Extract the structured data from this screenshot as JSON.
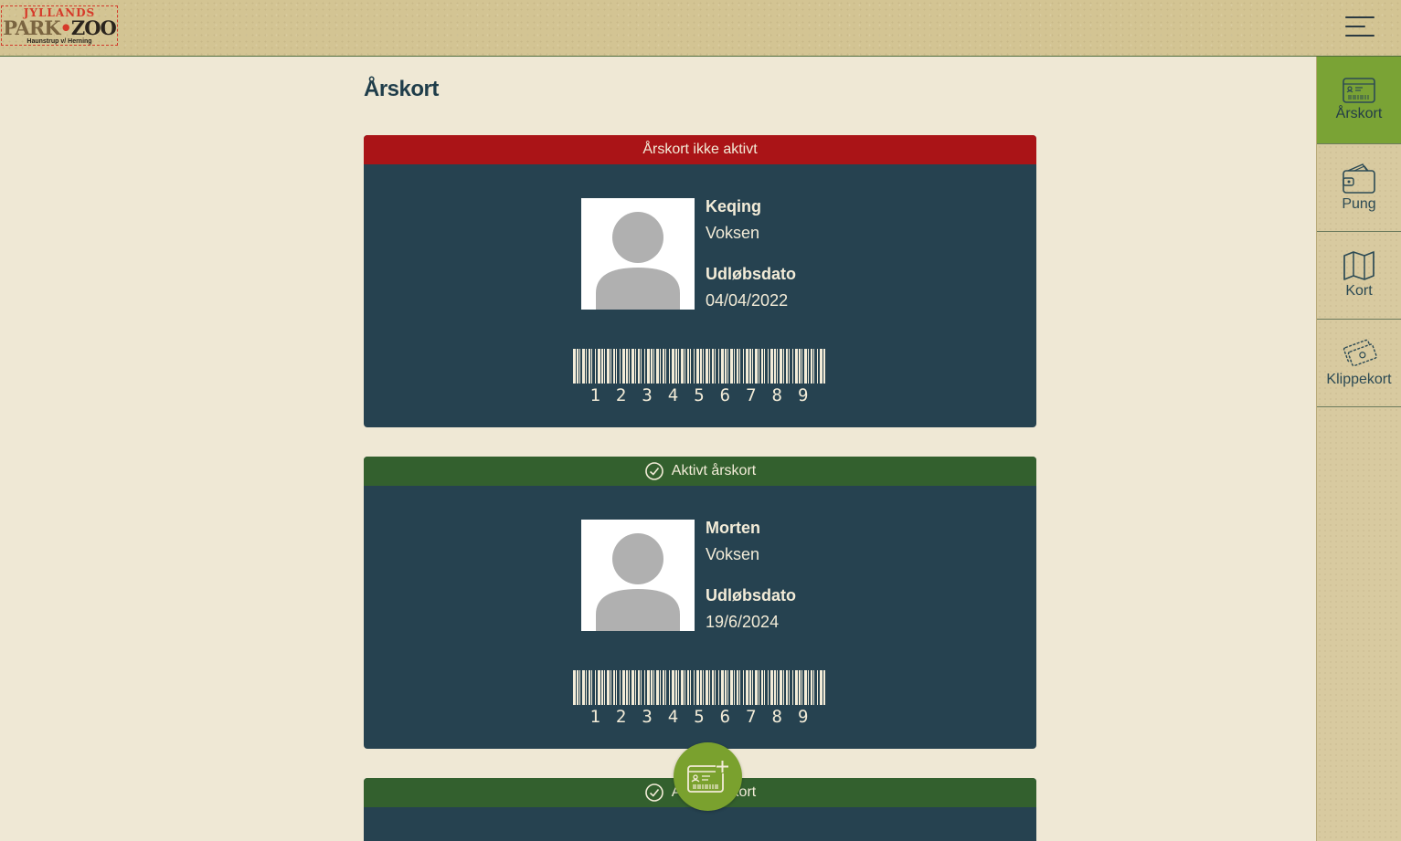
{
  "logo": {
    "line1": "JYLLANDS",
    "park": "PARK",
    "zoo": "ZOO",
    "tagline": "Haunstrup v/ Herning"
  },
  "header": {
    "menu_icon": "hamburger-menu-icon"
  },
  "page": {
    "title": "Årskort"
  },
  "sidebar": {
    "items": [
      {
        "label": "Årskort",
        "icon": "membership-card-icon",
        "active": true
      },
      {
        "label": "Pung",
        "icon": "wallet-icon",
        "active": false
      },
      {
        "label": "Kort",
        "icon": "map-icon",
        "active": false
      },
      {
        "label": "Klippekort",
        "icon": "tickets-icon",
        "active": false
      }
    ]
  },
  "cards": [
    {
      "status": "Årskort ikke aktivt",
      "status_type": "inactive",
      "name": "Keqing",
      "type": "Voksen",
      "expiry_label": "Udløbsdato",
      "expiry": "04/04/2022",
      "barcode_digits": [
        "1",
        "2",
        "3",
        "4",
        "5",
        "6",
        "7",
        "8",
        "9"
      ]
    },
    {
      "status": "Aktivt årskort",
      "status_type": "active",
      "name": "Morten",
      "type": "Voksen",
      "expiry_label": "Udløbsdato",
      "expiry": "19/6/2024",
      "barcode_digits": [
        "1",
        "2",
        "3",
        "4",
        "5",
        "6",
        "7",
        "8",
        "9"
      ]
    },
    {
      "status": "Aktivt årskort",
      "status_type": "active"
    }
  ],
  "fab": {
    "icon": "add-card-icon"
  },
  "colors": {
    "inactive": "#aa1417",
    "active": "#33602e",
    "card_bg": "#264250",
    "accent_green": "#7aa335"
  }
}
